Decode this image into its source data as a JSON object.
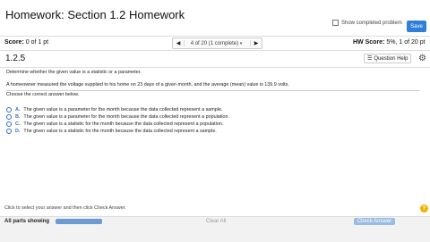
{
  "header": {
    "title": "Homework: Section 1.2 Homework",
    "show_completed_label": "Show completed problem",
    "save_label": "Save"
  },
  "scorebar": {
    "score_label": "Score:",
    "score_value": "0 of 1 pt",
    "nav_label": "4 of 20 (1 complete)",
    "nav_dropdown": "▾",
    "prev_icon": "◀",
    "next_icon": "▶",
    "hw_score_label": "HW Score:",
    "hw_score_value": "5%, 1 of 20 pt"
  },
  "question": {
    "number": "1.2.5",
    "help_label": "Question Help",
    "help_icon": "☰",
    "settings_icon": "⚙",
    "instruction": "Determine whether the given value is a statistic or a parameter.",
    "prompt": "A homeowner measured the voltage supplied to his home on 23 days of a given month, and the average (mean) value is 139.9 volts.",
    "choose_label": "Choose the correct answer below.",
    "options": [
      {
        "letter": "A.",
        "text": "The given value is a parameter for the month because the data collected represent a sample."
      },
      {
        "letter": "B.",
        "text": "The given value is a parameter for the month because the data collected represent a population."
      },
      {
        "letter": "C.",
        "text": "The given value is a statistic for the month because the data collected represent a population."
      },
      {
        "letter": "D.",
        "text": "The given value is a statistic for the month because the data collected represent a sample."
      }
    ]
  },
  "footer": {
    "hint": "Click to select your answer and then click Check Answer.",
    "help_icon": "?",
    "all_parts_label": "All parts showing",
    "clear_all_label": "Clear All",
    "check_answer_label": "Check Answer"
  },
  "colors": {
    "accent": "#2f7fd8",
    "option_letter": "#2f6fc4",
    "check_button": "#9bbce2",
    "help_badge": "#f0b400"
  }
}
